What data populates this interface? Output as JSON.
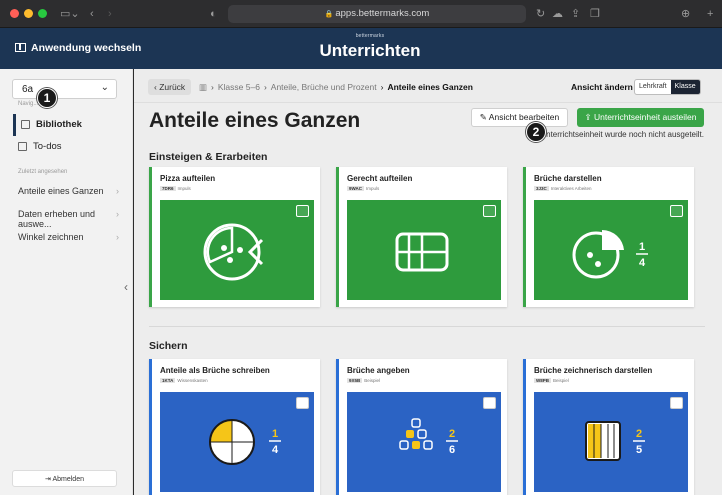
{
  "browser": {
    "url": "apps.bettermarks.com"
  },
  "appbar": {
    "switch_label": "Anwendung wechseln",
    "brand_small": "bettermarks",
    "title": "Unterrichten"
  },
  "sidebar": {
    "class_value": "6a",
    "nav_label": "Navig...",
    "items": [
      {
        "label": "Bibliothek",
        "active": true
      },
      {
        "label": "To-dos",
        "active": false
      }
    ],
    "recent_label": "Zuletzt angesehen",
    "recent": [
      {
        "label": "Anteile eines Ganzen"
      },
      {
        "label": "Daten erheben und auswe..."
      },
      {
        "label": "Winkel zeichnen"
      }
    ],
    "logout_label": "Abmelden"
  },
  "callouts": {
    "one": "1",
    "two": "2"
  },
  "breadcrumb": {
    "back_label": "Zurück",
    "items": [
      "Klasse 5–6",
      "Anteile, Brüche und Prozent",
      "Anteile eines Ganzen"
    ]
  },
  "view": {
    "label": "Ansicht ändern",
    "options": [
      "Lehrkraft",
      "Klasse"
    ],
    "selected": "Klasse"
  },
  "main": {
    "title": "Anteile eines Ganzen",
    "edit_label": "Ansicht bearbeiten",
    "share_label": "Unterrichtseinheit austeilen",
    "notice": "Die Unterrichtseinheit wurde noch nicht ausgeteilt."
  },
  "sections": [
    {
      "title": "Einsteigen & Erarbeiten",
      "cards": [
        {
          "title": "Pizza aufteilen",
          "code": "7DR6",
          "type": "Impuls",
          "fraction": null
        },
        {
          "title": "Gerecht aufteilen",
          "code": "9WAC",
          "type": "Impuls",
          "fraction": null
        },
        {
          "title": "Brüche darstellen",
          "code": "3J3C",
          "type": "Interaktives Arbeiten",
          "fraction": {
            "num": "1",
            "den": "4"
          }
        }
      ]
    },
    {
      "title": "Sichern",
      "cards": [
        {
          "title": "Anteile als Brüche schreiben",
          "code": "1KTA",
          "type": "Wissenskasten",
          "fraction": {
            "num": "1",
            "den": "4"
          }
        },
        {
          "title": "Brüche angeben",
          "code": "9X5B",
          "type": "Beispiel",
          "fraction": {
            "num": "2",
            "den": "6"
          }
        },
        {
          "title": "Brüche zeichnerisch darstellen",
          "code": "W8PB",
          "type": "Beispiel",
          "fraction": {
            "num": "2",
            "den": "5"
          }
        }
      ]
    }
  ],
  "colors": {
    "navy": "#1c3554",
    "green": "#3aa548",
    "blue": "#2a6fd6",
    "fraction_yellow": "#f5c518"
  }
}
